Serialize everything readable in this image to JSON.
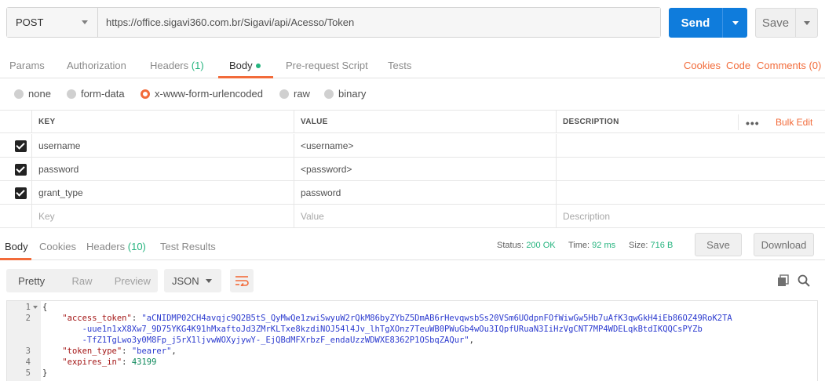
{
  "request": {
    "method": "POST",
    "url": "https://office.sigavi360.com.br/Sigavi/api/Acesso/Token",
    "send_label": "Send",
    "save_label": "Save"
  },
  "request_tabs": {
    "params": "Params",
    "authorization": "Authorization",
    "headers": "Headers",
    "headers_count": "(1)",
    "body": "Body",
    "prerequest": "Pre-request Script",
    "tests": "Tests",
    "cookies": "Cookies",
    "code": "Code",
    "comments": "Comments (0)"
  },
  "body_types": {
    "none": "none",
    "form_data": "form-data",
    "urlencoded": "x-www-form-urlencoded",
    "raw": "raw",
    "binary": "binary",
    "selected": "x-www-form-urlencoded"
  },
  "params_table": {
    "columns": {
      "key": "KEY",
      "value": "VALUE",
      "description": "DESCRIPTION"
    },
    "bulk_edit": "Bulk Edit",
    "rows": [
      {
        "key": "username",
        "value": "<username>",
        "description": ""
      },
      {
        "key": "password",
        "value": "<password>",
        "description": ""
      },
      {
        "key": "grant_type",
        "value": "password",
        "description": ""
      }
    ],
    "placeholders": {
      "key": "Key",
      "value": "Value",
      "description": "Description"
    }
  },
  "response_tabs": {
    "body": "Body",
    "cookies": "Cookies",
    "headers": "Headers",
    "headers_count": "(10)",
    "test_results": "Test Results"
  },
  "response_status": {
    "status_label": "Status:",
    "status_value": "200 OK",
    "time_label": "Time:",
    "time_value": "92 ms",
    "size_label": "Size:",
    "size_value": "716 B",
    "save_label": "Save",
    "download_label": "Download"
  },
  "response_toolbar": {
    "pretty": "Pretty",
    "raw": "Raw",
    "preview": "Preview",
    "format": "JSON"
  },
  "code_lines": {
    "l1_num": "1",
    "l1": "{",
    "l2_num": "2",
    "l2_key": "\"access_token\"",
    "l2_val_a": "\"aCNIDMP02CH4avqjc9Q2B5tS_QyMwQe1zwiSwyuW2rQkM86byZYbZ5DmAB6rHevqwsbSs20VSm6UOdpnFOfWiwGw5Hb7uAfK3qwGkH4iEb86OZ49RoK2TA",
    "l2_val_b": "-uue1n1xX8Xw7_9D75YKG4K91hMxaftoJd3ZMrKLTxe8kzdiNOJ54l4Jv_lhTgXOnz7TeuWB0PWuGb4wOu3IQpfURuaN3IiHzVgCNT7MP4WDELqkBtdIKQQCsPYZb",
    "l2_val_c": "-TfZ1TgLwo3y0M8Fp_j5rX1ljvwWOXyjywY-_EjQBdMFXrbzF_endaUzzWDWXE8362P1OSbqZAQur\"",
    "l3_num": "3",
    "l3_key": "\"token_type\"",
    "l3_val": "\"bearer\"",
    "l4_num": "4",
    "l4_key": "\"expires_in\"",
    "l4_val": "43199",
    "l5_num": "5",
    "l5": "}"
  },
  "colors": {
    "accent": "#f26b3a",
    "send": "#0f7cdc",
    "success": "#26b47f"
  }
}
